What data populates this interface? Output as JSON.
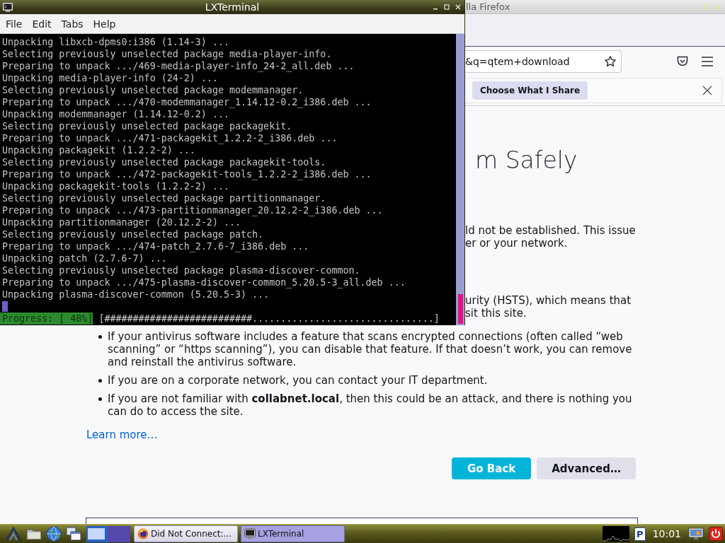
{
  "terminal_window": {
    "title": "LXTerminal",
    "menu": [
      {
        "label": "File"
      },
      {
        "label": "Edit"
      },
      {
        "label": "Tabs"
      },
      {
        "label": "Help"
      }
    ],
    "lines": [
      "Unpacking libxcb-dpms0:i386 (1.14-3) ...",
      "Selecting previously unselected package media-player-info.",
      "Preparing to unpack .../469-media-player-info_24-2_all.deb ...",
      "Unpacking media-player-info (24-2) ...",
      "Selecting previously unselected package modemmanager.",
      "Preparing to unpack .../470-modemmanager_1.14.12-0.2_i386.deb ...",
      "Unpacking modemmanager (1.14.12-0.2) ...",
      "Selecting previously unselected package packagekit.",
      "Preparing to unpack .../471-packagekit_1.2.2-2_i386.deb ...",
      "Unpacking packagekit (1.2.2-2) ...",
      "Selecting previously unselected package packagekit-tools.",
      "Preparing to unpack .../472-packagekit-tools_1.2.2-2_i386.deb ...",
      "Unpacking packagekit-tools (1.2.2-2) ...",
      "Selecting previously unselected package partitionmanager.",
      "Preparing to unpack .../473-partitionmanager_20.12.2-2_i386.deb ...",
      "Unpacking partitionmanager (20.12.2-2) ...",
      "Selecting previously unselected package patch.",
      "Preparing to unpack .../474-patch_2.7.6-7_i386.deb ...",
      "Unpacking patch (2.7.6-7) ...",
      "Selecting previously unselected package plasma-discover-common.",
      "Preparing to unpack .../475-plasma-discover-common_5.20.5-3_all.deb ...",
      "Unpacking plasma-discover-common (5.20.5-3) ..."
    ],
    "progress": {
      "label": "Progress: [ 48%]",
      "bar": "[##########################................................]"
    }
  },
  "browser_window": {
    "title": "lla Firefox",
    "address": "&q=qtem+download",
    "notification_button": "Choose What I Share",
    "page": {
      "heading": "m Safely",
      "paragraphs": [
        [
          "ld not be established. This issue",
          "er or your network."
        ],
        [
          "urity (HSTS), which means that",
          "sit this site."
        ]
      ],
      "bullets": [
        "If your antivirus software includes a feature that scans encrypted connections (often called “web scanning” or “https scanning”), you can disable that feature. If that doesn’t work, you can remove and reinstall the antivirus software.",
        "If you are on a corporate network, you can contact your IT department.",
        "If you are not familiar with **collabnet.local**, then this could be an attack, and there is nothing you can do to access the site."
      ],
      "learn_more": "Learn more…",
      "buttons": [
        {
          "label": "Go Back",
          "kind": "primary"
        },
        {
          "label": "Advanced…",
          "kind": "secondary"
        }
      ]
    }
  },
  "taskbar": {
    "workspaces": [
      {
        "selected": true
      },
      {
        "selected": false
      }
    ],
    "tasks": [
      {
        "label": "Did Not Connect:...",
        "kind": "browser",
        "selected": false
      },
      {
        "label": "LXTerminal",
        "kind": "terminal",
        "selected": true
      }
    ],
    "tray_letter": "P",
    "clock": "10:01"
  }
}
